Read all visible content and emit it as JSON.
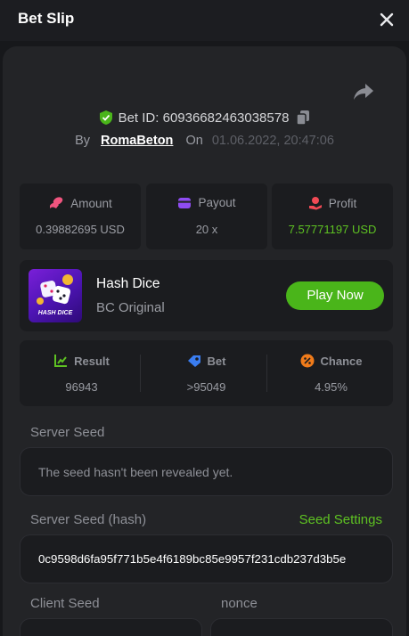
{
  "header": {
    "title": "Bet Slip"
  },
  "bet": {
    "id_label": "Bet ID: 60936682463038578",
    "by_label": "By",
    "username": "RomaBeton",
    "on_label": "On",
    "datetime": "01.06.2022, 20:47:06"
  },
  "stats": [
    {
      "label": "Amount",
      "value": "0.39882695 USD",
      "icon": "coins-icon",
      "color": "#f0557f"
    },
    {
      "label": "Payout",
      "value": "20 x",
      "icon": "wallet-icon",
      "color": "#8f4cf2"
    },
    {
      "label": "Profit",
      "value": "7.57771197 USD",
      "icon": "profit-hand-icon",
      "color": "#f24a55"
    }
  ],
  "game": {
    "name": "Hash Dice",
    "provider": "BC Original",
    "thumb_text": "HASH DICE",
    "play_label": "Play Now"
  },
  "result": [
    {
      "label": "Result",
      "value": "96943",
      "icon": "result-chart-icon",
      "color": "#5ec222"
    },
    {
      "label": "Bet",
      "value": ">95049",
      "icon": "bet-tag-icon",
      "color": "#3a7df0"
    },
    {
      "label": "Chance",
      "value": "4.95%",
      "icon": "percent-icon",
      "color": "#f07b1a"
    }
  ],
  "seeds": {
    "server_seed_label": "Server Seed",
    "server_seed_value": "The seed hasn't been revealed yet.",
    "server_hash_label": "Server Seed (hash)",
    "seed_settings_label": "Seed Settings",
    "server_hash_value": "0c9598d6fa95f771b5e4f6189bc85e9957f231cdb237d3b5e",
    "client_seed_label": "Client Seed",
    "nonce_label": "nonce"
  },
  "colors": {
    "accent_green": "#5ec222",
    "play_button": "#4ab51a"
  }
}
